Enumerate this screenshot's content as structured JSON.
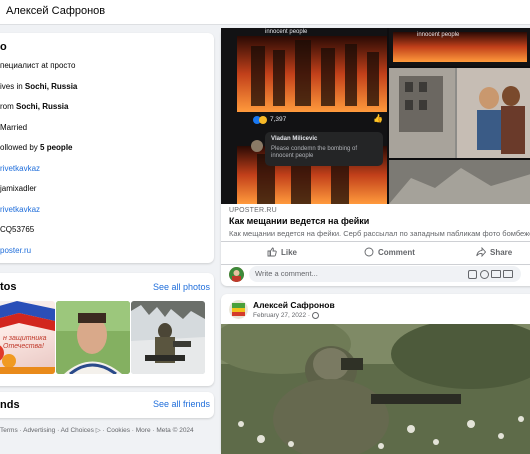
{
  "topbar": {
    "profile_name": "Алексей Сафронов"
  },
  "intro": {
    "title": "o",
    "rows": [
      {
        "pre": "пециалист at просто",
        "bold": "",
        "post": ""
      },
      {
        "pre": "ives in ",
        "bold": "Sochi, Russia",
        "post": ""
      },
      {
        "pre": "rom ",
        "bold": "Sochi, Russia",
        "post": ""
      },
      {
        "pre": "Married",
        "bold": "",
        "post": ""
      },
      {
        "pre": "ollowed by ",
        "bold": "5 people",
        "post": ""
      }
    ],
    "links": [
      "rivetkavkaz",
      "jamixadler",
      "rivetkavkaz",
      "CQ53765",
      "poster.ru"
    ]
  },
  "photos": {
    "title": "tos",
    "see_all": "See all photos",
    "thumb1_text": "н защитника Отечества!"
  },
  "friends": {
    "title": "nds",
    "see_all": "See all friends"
  },
  "footer": "Terms · Advertising · Ad Choices ▷ · Cookies · More · Meta © 2024",
  "post1": {
    "source": "UPOSTER.RU",
    "title": "Как мещании ведется на фейки",
    "description": "Как мещании ведется на фейки. Серб рассылал по западным пабликам фото бомбежек",
    "like": "Like",
    "comment": "Comment",
    "share": "Share",
    "write_comment": "Write a comment...",
    "media": {
      "caption_top_left": "innocent people",
      "caption_top_right": "innocent people",
      "reaction_count": "7,397",
      "comment_author": "Vladan Milicevic",
      "comment_text": "Please condemn the bombing of innocent people"
    }
  },
  "post2": {
    "author": "Алексей Сафронов",
    "date": "February 27, 2022 ·"
  },
  "colors": {
    "link": "#216fdb",
    "muted": "#65676b",
    "bg": "#f0f2f5"
  }
}
